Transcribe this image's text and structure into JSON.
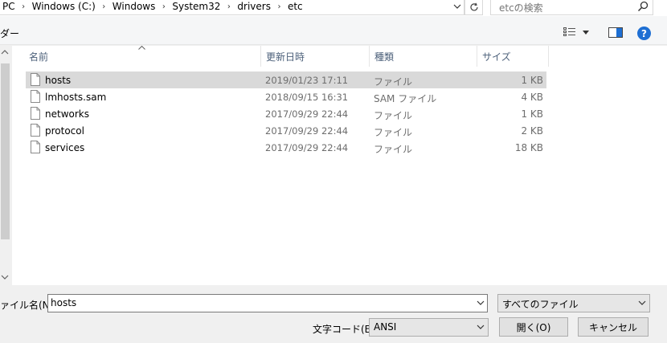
{
  "address": {
    "crumbs": [
      "PC",
      "Windows (C:)",
      "Windows",
      "System32",
      "drivers",
      "etc"
    ],
    "separator": "›"
  },
  "search": {
    "placeholder": "etcの検索"
  },
  "toolbar": {
    "folder_label": "ダー"
  },
  "columns": {
    "name": "名前",
    "date": "更新日時",
    "type": "種類",
    "size": "サイズ"
  },
  "files": [
    {
      "name": "hosts",
      "date": "2019/01/23 17:11",
      "type": "ファイル",
      "size": "1 KB",
      "selected": true
    },
    {
      "name": "lmhosts.sam",
      "date": "2018/09/15 16:31",
      "type": "SAM ファイル",
      "size": "4 KB",
      "selected": false
    },
    {
      "name": "networks",
      "date": "2017/09/29 22:44",
      "type": "ファイル",
      "size": "1 KB",
      "selected": false
    },
    {
      "name": "protocol",
      "date": "2017/09/29 22:44",
      "type": "ファイル",
      "size": "2 KB",
      "selected": false
    },
    {
      "name": "services",
      "date": "2017/09/29 22:44",
      "type": "ファイル",
      "size": "18 KB",
      "selected": false
    }
  ],
  "bottom": {
    "filename_label": "ァイル名(N):",
    "filename_value": "hosts",
    "filter_value": "すべてのファイル",
    "encoding_label": "文字コード(E):",
    "encoding_value": "ANSI",
    "open_label": "開く(O)",
    "cancel_label": "キャンセル"
  },
  "colors": {
    "selected_row": "#d9d9d9",
    "help_blue": "#1e6fd3",
    "header_text": "#4c607a"
  }
}
